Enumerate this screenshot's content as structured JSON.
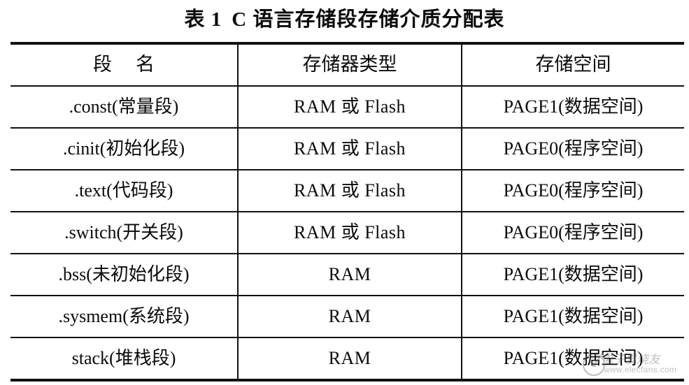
{
  "caption": {
    "label": "表",
    "number": "1",
    "title": "C 语言存储段存储介质分配表"
  },
  "table": {
    "headers": {
      "col1_part1": "段",
      "col1_part2": "名",
      "col2": "存储器类型",
      "col3": "存储空间"
    },
    "rows": [
      {
        "segment": ".const(常量段)",
        "memory_type": "RAM 或 Flash",
        "memory_space": "PAGE1(数据空间)"
      },
      {
        "segment": ".cinit(初始化段)",
        "memory_type": "RAM 或 Flash",
        "memory_space": "PAGE0(程序空间)"
      },
      {
        "segment": ".text(代码段)",
        "memory_type": "RAM 或 Flash",
        "memory_space": "PAGE0(程序空间)"
      },
      {
        "segment": ".switch(开关段)",
        "memory_type": "RAM 或 Flash",
        "memory_space": "PAGE0(程序空间)"
      },
      {
        "segment": ".bss(未初始化段)",
        "memory_type": "RAM",
        "memory_space": "PAGE1(数据空间)"
      },
      {
        "segment": ".sysmem(系统段)",
        "memory_type": "RAM",
        "memory_space": "PAGE1(数据空间)"
      },
      {
        "segment": "stack(堆栈段)",
        "memory_type": "RAM",
        "memory_space": "PAGE1(数据空间)"
      }
    ]
  },
  "watermark": {
    "brand": "电子发烧友",
    "url": "www.elecfans.com"
  },
  "colors": {
    "rule": "#111111",
    "text": "#0a0a0a",
    "page_background": "#ffffff",
    "watermark_text": "#6b6b6b"
  }
}
